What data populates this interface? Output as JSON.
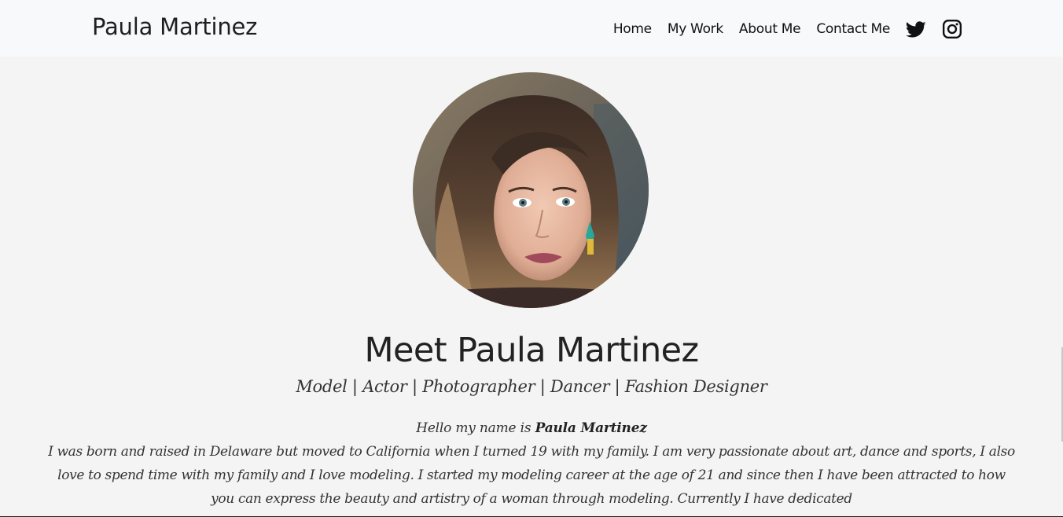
{
  "navbar": {
    "brand": "Paula Martinez",
    "links": [
      "Home",
      "My Work",
      "About Me",
      "Contact Me"
    ],
    "social_icons": [
      "twitter-icon",
      "instagram-icon"
    ]
  },
  "hero": {
    "avatar_alt": "Portrait of Paula Martinez",
    "title": "Meet Paula Martinez",
    "subtitle": "Model | Actor | Photographer | Dancer | Fashion Designer"
  },
  "about": {
    "intro_prefix": "Hello my name is",
    "intro_name": "Paula Martinez",
    "bio": "I was born and raised in Delaware but moved to California when I turned 19 with my family. I am very passionate about art, dance and sports, I also love to spend time with my family and I love modeling. I started my modeling career at the age of 21 and since then I have been attracted to how you can express the beauty and artistry of a woman through modeling. Currently I have dedicated"
  },
  "colors": {
    "background": "#f4f4f4",
    "navbar": "#f8f9fa",
    "text": "#212529"
  }
}
